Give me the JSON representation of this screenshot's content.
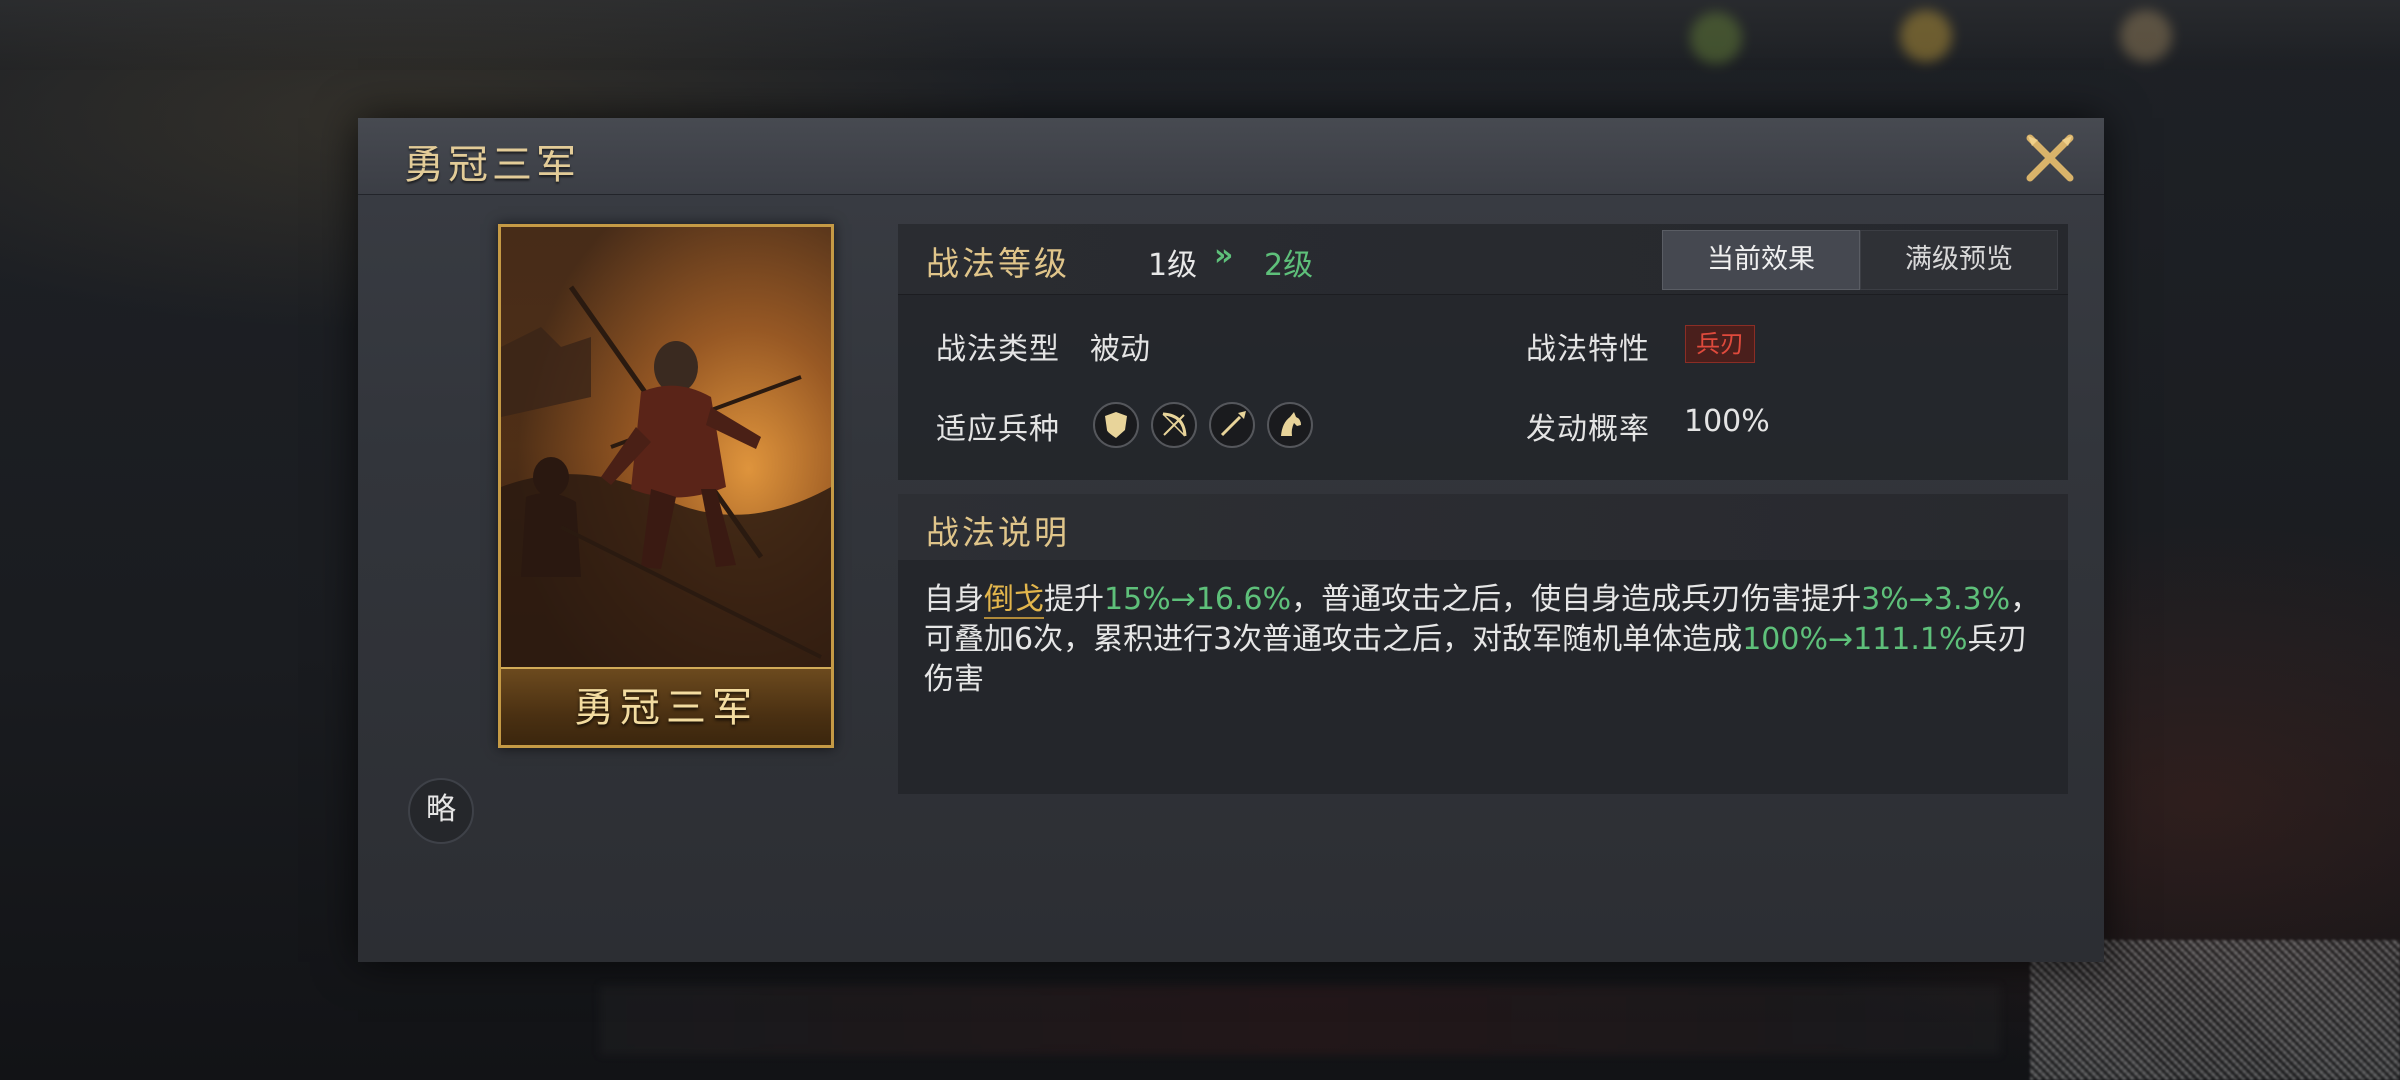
{
  "dialog": {
    "title": "勇冠三军"
  },
  "card": {
    "name": "勇冠三军",
    "type_badge": "略"
  },
  "level": {
    "label": "战法等级",
    "current": "1级",
    "arrow": "»",
    "next": "2级"
  },
  "tabs": {
    "current_effect": "当前效果",
    "max_preview": "满级预览"
  },
  "attributes": {
    "type_label": "战法类型",
    "type_value": "被动",
    "trait_label": "战法特性",
    "trait_value": "兵刃",
    "troop_label": "适应兵种",
    "troop_icons": [
      "shield-icon",
      "bow-icon",
      "spear-icon",
      "horse-icon"
    ],
    "chance_label": "发动概率",
    "chance_value": "100%"
  },
  "description": {
    "title": "战法说明",
    "segments": [
      {
        "text": "自身",
        "style": "normal"
      },
      {
        "text": "倒戈",
        "style": "keyword"
      },
      {
        "text": "提升",
        "style": "normal"
      },
      {
        "text": "15%→16.6%",
        "style": "green"
      },
      {
        "text": "，普通攻击之后，使自身造成兵刃伤害提升",
        "style": "normal"
      },
      {
        "text": "3%→3.3%",
        "style": "green"
      },
      {
        "text": "，可叠加6次，累积进行3次普通攻击之后，对敌军随机单体造成",
        "style": "normal"
      },
      {
        "text": "100%→111.1%",
        "style": "green"
      },
      {
        "text": "兵刃伤害",
        "style": "normal"
      }
    ]
  },
  "colors": {
    "gold": "#e0c58a",
    "green": "#5ec07a",
    "trait_red": "#e04a3c"
  }
}
